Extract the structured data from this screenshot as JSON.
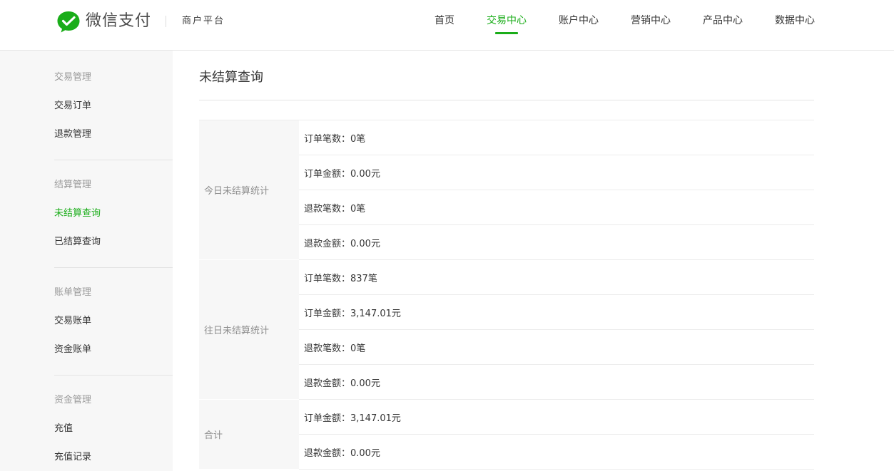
{
  "header": {
    "brand": "微信支付",
    "subbrand": "商户平台",
    "nav": [
      {
        "label": "首页",
        "active": false
      },
      {
        "label": "交易中心",
        "active": true
      },
      {
        "label": "账户中心",
        "active": false
      },
      {
        "label": "营销中心",
        "active": false
      },
      {
        "label": "产品中心",
        "active": false
      },
      {
        "label": "数据中心",
        "active": false
      }
    ]
  },
  "sidebar": {
    "groups": [
      {
        "title": "交易管理",
        "items": [
          {
            "label": "交易订单"
          },
          {
            "label": "退款管理"
          }
        ]
      },
      {
        "title": "结算管理",
        "items": [
          {
            "label": "未结算查询",
            "active": true
          },
          {
            "label": "已结算查询"
          }
        ]
      },
      {
        "title": "账单管理",
        "items": [
          {
            "label": "交易账单"
          },
          {
            "label": "资金账单"
          }
        ]
      },
      {
        "title": "资金管理",
        "items": [
          {
            "label": "充值"
          },
          {
            "label": "充值记录"
          }
        ]
      }
    ]
  },
  "main": {
    "title": "未结算查询",
    "sections": [
      {
        "label": "今日未结算统计",
        "rows": [
          "订单笔数：0笔",
          "订单金额：0.00元",
          "退款笔数：0笔",
          "退款金额：0.00元"
        ]
      },
      {
        "label": "往日未结算统计",
        "rows": [
          "订单笔数：837笔",
          "订单金额：3,147.01元",
          "退款笔数：0笔",
          "退款金额：0.00元"
        ]
      },
      {
        "label": "合计",
        "rows": [
          "订单金额：3,147.01元",
          "退款金额：0.00元"
        ]
      }
    ]
  },
  "colors": {
    "accent": "#1aad19",
    "sidebar_bg": "#f7f7f7"
  },
  "icons": {
    "logo": "wechat-pay-logo-icon"
  }
}
